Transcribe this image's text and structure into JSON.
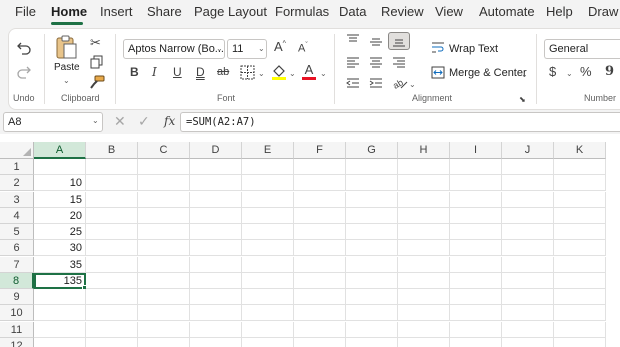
{
  "menu": {
    "tabs": [
      "File",
      "Home",
      "Insert",
      "Share",
      "Page Layout",
      "Formulas",
      "Data",
      "Review",
      "View",
      "Automate",
      "Help",
      "Draw"
    ],
    "active": "Home"
  },
  "ribbon": {
    "undo": {
      "group_label": "Undo"
    },
    "clipboard": {
      "paste_label": "Paste",
      "group_label": "Clipboard"
    },
    "font": {
      "font_name": "Aptos Narrow (Bo...",
      "font_size": "11",
      "bold": "B",
      "italic": "I",
      "underline": "U",
      "double_underline": "D",
      "strikethrough": "ab",
      "grow": "A",
      "shrink": "A",
      "font_color_glyph": "A",
      "fill_color": "#ffff00",
      "font_color": "#e81123",
      "group_label": "Font"
    },
    "alignment": {
      "wrap_text_label": "Wrap Text",
      "merge_label": "Merge & Center",
      "group_label": "Alignment"
    },
    "number": {
      "format": "General",
      "currency_glyph": "$",
      "percent_glyph": "%",
      "comma_glyph": "9",
      "group_label": "Number"
    }
  },
  "formula_bar": {
    "name_box": "A8",
    "fx_label": "fx",
    "formula": "=SUM(A2:A7)"
  },
  "sheet": {
    "columns": [
      "A",
      "B",
      "C",
      "D",
      "E",
      "F",
      "G",
      "H",
      "I",
      "J",
      "K"
    ],
    "rows": [
      "1",
      "2",
      "3",
      "4",
      "5",
      "6",
      "7",
      "8",
      "9",
      "10",
      "11",
      "12"
    ],
    "column_a_values": [
      "",
      "10",
      "15",
      "20",
      "25",
      "30",
      "35",
      "135",
      "",
      "",
      "",
      ""
    ],
    "selected_cell": "A8"
  },
  "colors": {
    "accent": "#1e7145",
    "header_selected": "#d2e8d9"
  }
}
